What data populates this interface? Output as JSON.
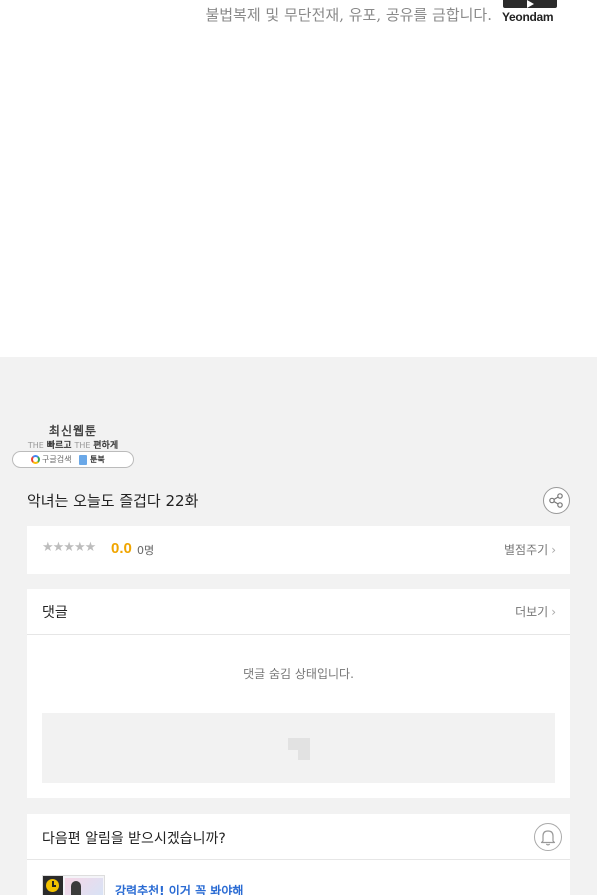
{
  "viewer": {
    "copyright_line": "불법복제 및 무단전재, 유포, 공유를 금합니다.",
    "brand_logo_text": "Yeondam"
  },
  "promo_banner": {
    "title": "최신웹툰",
    "the_1": "THE",
    "word_1": "빠르고",
    "the_2": "THE",
    "word_2": "편하게",
    "search_label": "구글검색",
    "toon_label": "툰북"
  },
  "episode": {
    "title": "악녀는 오늘도 즐겁다 22화"
  },
  "rating": {
    "stars_text": "★★★★★",
    "stars_value": 0,
    "score": "0.0",
    "count": "0명",
    "rate_link": "별점주기"
  },
  "comments": {
    "heading": "댓글",
    "more_link": "더보기",
    "hidden_message": "댓글 숨김 상태입니다."
  },
  "notify": {
    "question": "다음편 알림을 받으시겠습니까?"
  },
  "recommend": {
    "title": "강력추천! 이거 꼭 봐야해"
  },
  "icons": {
    "chevron": "›",
    "share": "share-icon",
    "bell": "bell-icon",
    "write": "write-icon",
    "clock": "clock-icon"
  },
  "colors": {
    "score_accent": "#f0a500",
    "link_blue": "#2a6bd3",
    "page_bg": "#f2f2f2"
  }
}
